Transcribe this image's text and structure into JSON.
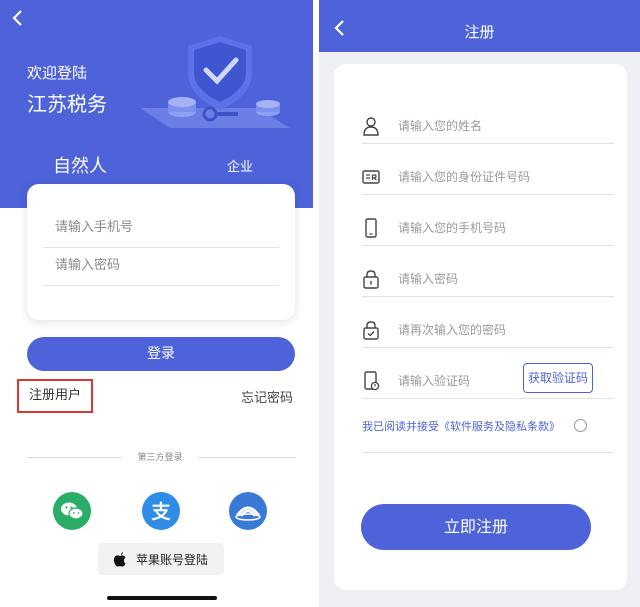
{
  "login": {
    "welcome": "欢迎登陆",
    "brand": "江苏税务",
    "tabs": [
      "自然人",
      "企业"
    ],
    "phone_placeholder": "请输入手机号",
    "password_placeholder": "请输入密码",
    "login_button": "登录",
    "register_link": "注册用户",
    "forgot_link": "忘记密码",
    "third_party_label": "第三方登录",
    "social_icons": [
      "wechat-icon",
      "alipay-icon",
      "tianyi-icon"
    ],
    "apple_login": "苹果账号登陆"
  },
  "register": {
    "title": "注册",
    "fields": [
      {
        "icon": "user-icon",
        "placeholder": "请输入您的姓名"
      },
      {
        "icon": "id-card-icon",
        "placeholder": "请输入您的身份证件号码"
      },
      {
        "icon": "phone-icon",
        "placeholder": "请输入您的手机号码"
      },
      {
        "icon": "lock-icon",
        "placeholder": "请输入密码"
      },
      {
        "icon": "lock-check-icon",
        "placeholder": "请再次输入您的密码"
      },
      {
        "icon": "verify-code-icon",
        "placeholder": "请输入验证码"
      }
    ],
    "get_code_button": "获取验证码",
    "agreement": "我已阅读并接受《软件服务及隐私条款》",
    "submit_button": "立即注册"
  },
  "colors": {
    "primary": "#4e63d9",
    "highlight_border": "#d63a30",
    "wechat": "#2aae67",
    "alipay": "#2f8de8"
  }
}
